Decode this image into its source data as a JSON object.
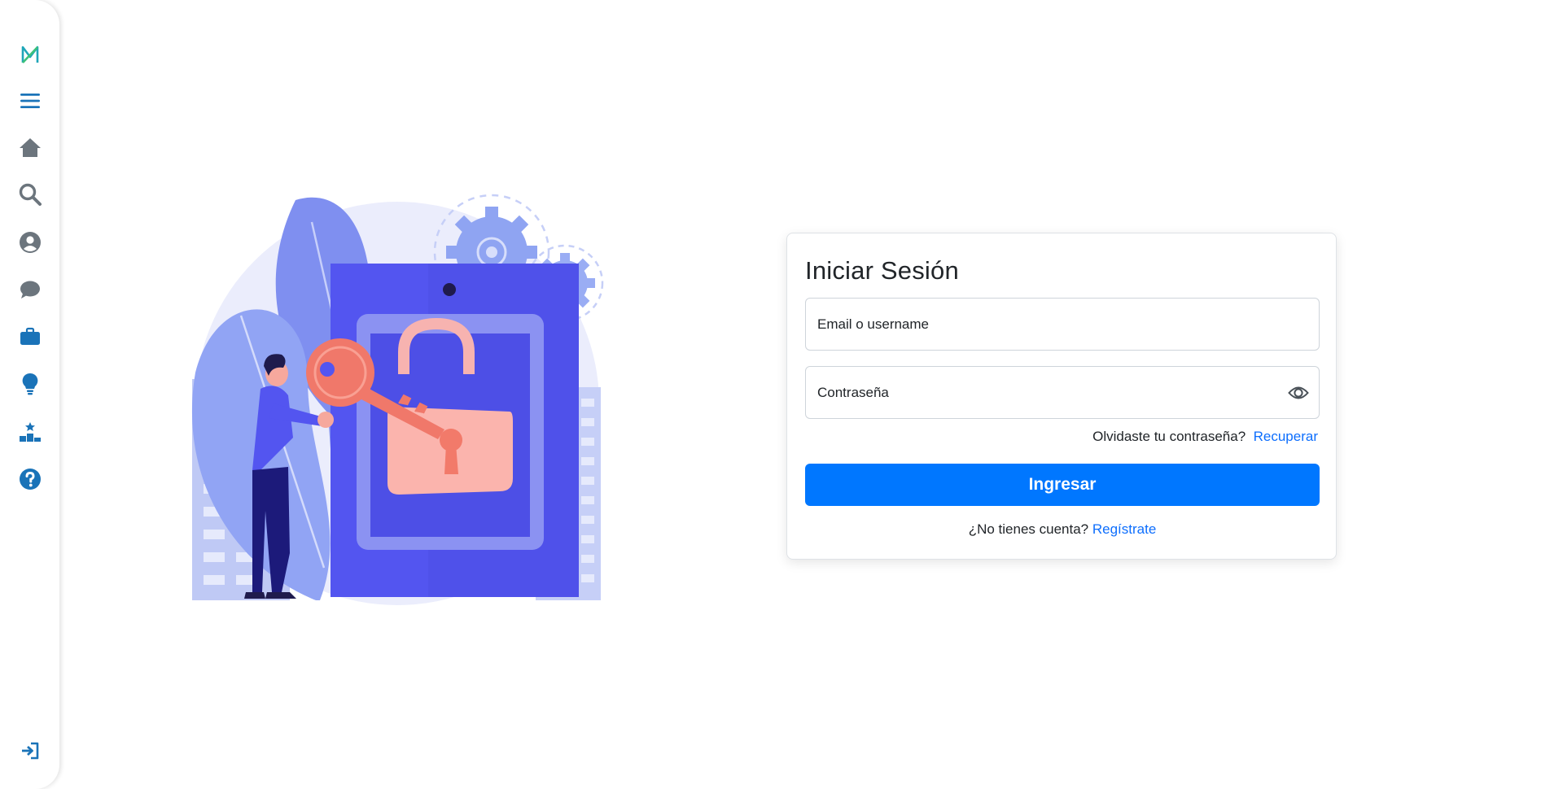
{
  "sidebar": {
    "items": [
      {
        "icon": "logo-icon"
      },
      {
        "icon": "menu-icon"
      },
      {
        "icon": "home-icon"
      },
      {
        "icon": "search-icon"
      },
      {
        "icon": "user-icon"
      },
      {
        "icon": "chat-icon"
      },
      {
        "icon": "briefcase-icon"
      },
      {
        "icon": "lightbulb-icon"
      },
      {
        "icon": "ranking-icon"
      },
      {
        "icon": "help-icon"
      },
      {
        "icon": "login-icon"
      }
    ]
  },
  "login": {
    "title": "Iniciar Sesión",
    "email_placeholder": "Email o username",
    "password_placeholder": "Contraseña",
    "forgot_text": "Olvidaste tu contraseña?",
    "forgot_link": "Recuperar",
    "submit_label": "Ingresar",
    "register_text": "¿No tienes cuenta?",
    "register_link": "Regístrate"
  },
  "colors": {
    "primary": "#0077ff",
    "link": "#0d6efd",
    "sidebar_icon_blue": "#1a73b8",
    "sidebar_icon_gray": "#6c757d",
    "illustration_purple": "#5355f0",
    "illustration_coral": "#f0786a"
  }
}
